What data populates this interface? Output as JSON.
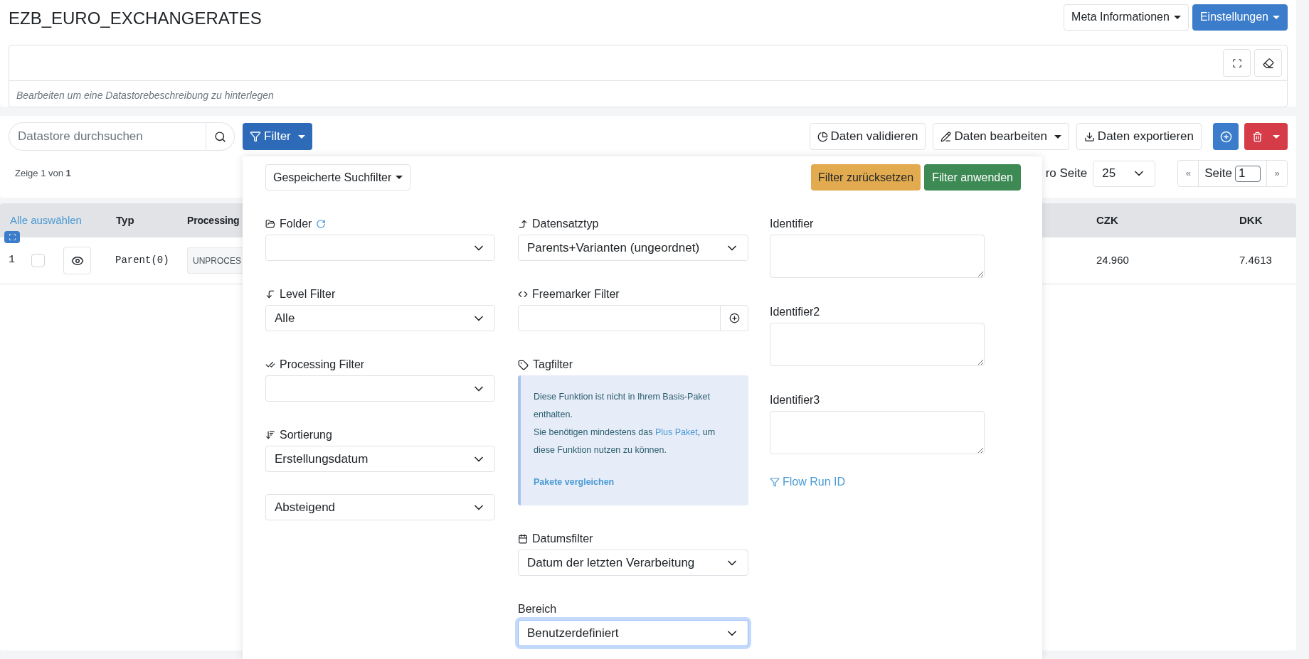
{
  "title": "EZB_EURO_EXCHANGERATES",
  "header_buttons": [
    {
      "label": "Meta Informationen",
      "kind": "light"
    },
    {
      "label": "Einstellungen",
      "kind": "primary"
    }
  ],
  "description": {
    "placeholder": "Bearbeiten um eine Datastorebeschreibung zu hinterlegen"
  },
  "search": {
    "placeholder": "Datastore durchsuchen"
  },
  "filter_button": {
    "label": "Filter",
    "expanded": true
  },
  "actions": [
    {
      "label": "Daten validieren",
      "dropdown": false
    },
    {
      "label": "Daten bearbeiten",
      "dropdown": true
    },
    {
      "label": "Daten exportieren",
      "dropdown": false
    }
  ],
  "result_count": "Zeige 1 von **1**",
  "per_page": {
    "label": "ro Seite",
    "value": "25"
  },
  "pagination": {
    "first": "«",
    "page_label": "Seite",
    "page": "1",
    "next": "»"
  },
  "table": {
    "select_all": "Alle auswählen",
    "columns": [
      "Typ",
      "Processing",
      "CZK",
      "DKK"
    ],
    "rows": [
      {
        "number": "1",
        "checked": false,
        "type": "Parent(0)",
        "processing": "UNPROCES",
        "czk": "24.960",
        "dkk": "7.4613"
      }
    ]
  },
  "filter_panel": {
    "saved_filters": "Gespeicherte Suchfilter",
    "reset": "Filter zurücksetzen",
    "apply": "Filter anwenden",
    "folder": {
      "label": "Folder"
    },
    "level_filter": {
      "label": "Level Filter",
      "value": "Alle"
    },
    "processing_filter": {
      "label": "Processing Filter"
    },
    "sorting": {
      "label": "Sortierung",
      "value": "Erstellungsdatum"
    },
    "order": {
      "value": "Absteigend"
    },
    "record_type": {
      "label": "Datensatztyp",
      "value": "Parents+Varianten (ungeordnet)"
    },
    "freemarker_filter": {
      "label": "Freemarker Filter"
    },
    "tag_filter": {
      "label": "Tagfilter",
      "notice": "Diese Funktion ist nicht in Ihrem Basis-Paket enthalten.",
      "notice_before": "Sie benötigen mindestens das",
      "notice_link": "Plus Paket",
      "notice_after": ", um diese Funktion nutzen zu können.",
      "compare_link": "Pakete vergleichen"
    },
    "date_filter": {
      "label": "Datumsfilter",
      "value": "Datum der letzten Verarbeitung"
    },
    "range": {
      "label": "Bereich",
      "value": "Benutzerdefiniert",
      "focused": true
    },
    "identifiers": [
      {
        "label": "Identifier"
      },
      {
        "label": "Identifier2"
      },
      {
        "label": "Identifier3"
      }
    ],
    "flow_run_id": "Flow Run ID"
  }
}
